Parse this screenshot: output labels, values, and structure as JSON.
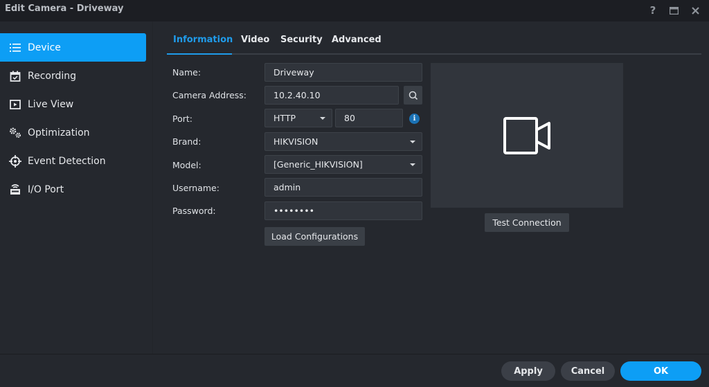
{
  "window": {
    "title": "Edit Camera - Driveway",
    "controls": {
      "help_icon": "?",
      "maximize_icon": "maximize-icon",
      "close_icon": "close-icon"
    }
  },
  "sidebar": {
    "items": [
      {
        "label": "Device",
        "icon": "list-icon",
        "active": true
      },
      {
        "label": "Recording",
        "icon": "calendar-check-icon",
        "active": false
      },
      {
        "label": "Live View",
        "icon": "play-box-icon",
        "active": false
      },
      {
        "label": "Optimization",
        "icon": "gears-icon",
        "active": false
      },
      {
        "label": "Event Detection",
        "icon": "crosshair-icon",
        "active": false
      },
      {
        "label": "I/O Port",
        "icon": "io-port-icon",
        "active": false
      }
    ]
  },
  "tabs": [
    {
      "label": "Information",
      "active": true
    },
    {
      "label": "Video",
      "active": false
    },
    {
      "label": "Security",
      "active": false
    },
    {
      "label": "Advanced",
      "active": false
    }
  ],
  "form": {
    "name": {
      "label": "Name:",
      "value": "Driveway"
    },
    "camera_address": {
      "label": "Camera Address:",
      "value": "10.2.40.10"
    },
    "port": {
      "label": "Port:",
      "protocol": "HTTP",
      "value": "80"
    },
    "brand": {
      "label": "Brand:",
      "value": "HIKVISION"
    },
    "model": {
      "label": "Model:",
      "value": "[Generic_HIKVISION]"
    },
    "username": {
      "label": "Username:",
      "value": "admin"
    },
    "password": {
      "label": "Password:",
      "value": "••••••••"
    },
    "load_configurations": "Load Configurations"
  },
  "preview": {
    "icon": "video-camera-icon",
    "test_connection": "Test Connection"
  },
  "footer": {
    "apply": "Apply",
    "cancel": "Cancel",
    "ok": "OK"
  },
  "colors": {
    "accent": "#0d9ef5",
    "tab_active": "#1f9bea",
    "background": "#25282e",
    "titlebar": "#1c1e23"
  }
}
